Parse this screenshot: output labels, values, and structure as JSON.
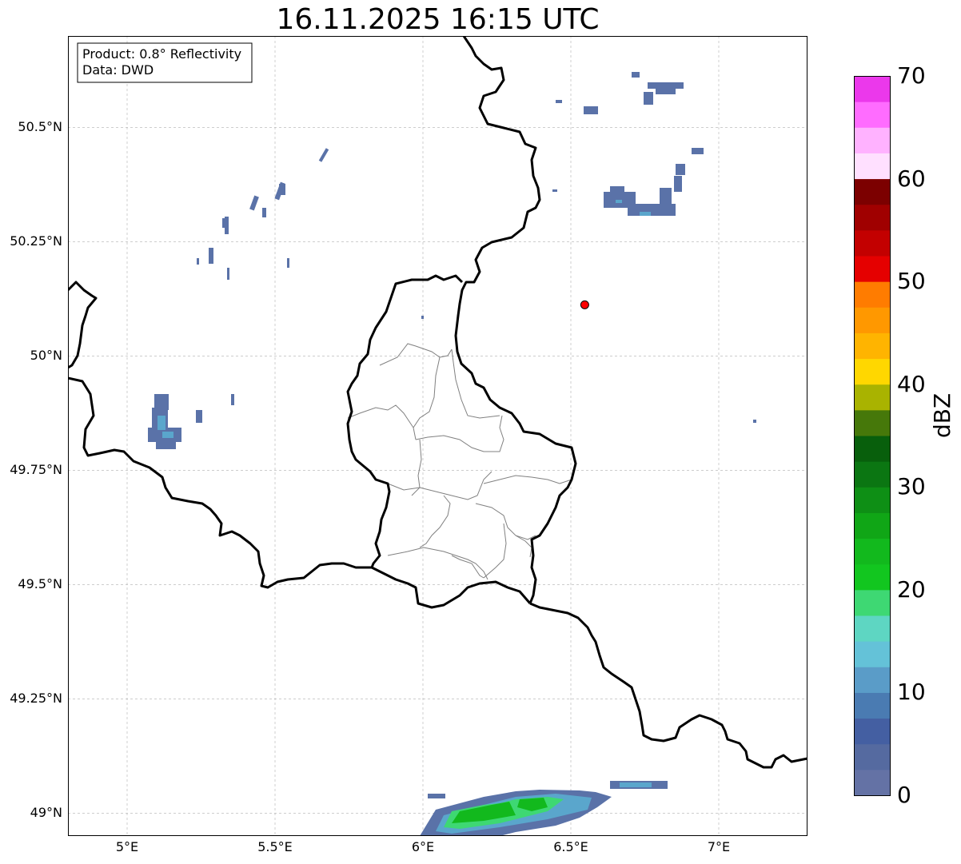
{
  "title": "16.11.2025 16:15 UTC",
  "info_box": {
    "line1": "Product: 0.8° Reflectivity",
    "line2": "Data: DWD"
  },
  "extent": {
    "lon_min": 4.8,
    "lon_max": 7.3,
    "lat_min": 48.95,
    "lat_max": 50.7
  },
  "axes": {
    "lon_ticks": [
      {
        "value": 5.0,
        "label": "5°E"
      },
      {
        "value": 5.5,
        "label": "5.5°E"
      },
      {
        "value": 6.0,
        "label": "6°E"
      },
      {
        "value": 6.5,
        "label": "6.5°E"
      },
      {
        "value": 7.0,
        "label": "7°E"
      }
    ],
    "lat_ticks": [
      {
        "value": 50.5,
        "label": "50.5°N"
      },
      {
        "value": 50.25,
        "label": "50.25°N"
      },
      {
        "value": 50.0,
        "label": "50°N"
      },
      {
        "value": 49.75,
        "label": "49.75°N"
      },
      {
        "value": 49.5,
        "label": "49.5°N"
      },
      {
        "value": 49.25,
        "label": "49.25°N"
      },
      {
        "value": 49.0,
        "label": "49°N"
      }
    ],
    "grid": true
  },
  "marker": {
    "lon": 6.547,
    "lat": 50.112,
    "color": "#ff0000",
    "icon": "radar-site-dot"
  },
  "colorbar": {
    "label": "dBZ",
    "min": 0,
    "max": 70,
    "ticks": [
      {
        "value": 0,
        "label": "0"
      },
      {
        "value": 10,
        "label": "10"
      },
      {
        "value": 20,
        "label": "20"
      },
      {
        "value": 30,
        "label": "30"
      },
      {
        "value": 40,
        "label": "40"
      },
      {
        "value": 50,
        "label": "50"
      },
      {
        "value": 60,
        "label": "60"
      },
      {
        "value": 70,
        "label": "70"
      }
    ],
    "colors": [
      "#6472a5",
      "#556aa0",
      "#445fa2",
      "#4a7bb2",
      "#5a9cc8",
      "#64c2d8",
      "#5ed6c2",
      "#3ed873",
      "#12c61f",
      "#12b91d",
      "#10a616",
      "#0e8f15",
      "#0b7612",
      "#085f0c",
      "#46780a",
      "#a9b300",
      "#ffd700",
      "#ffb400",
      "#ff9800",
      "#ff7c00",
      "#e50000",
      "#c30000",
      "#a00000",
      "#7c0000",
      "#ffe0ff",
      "#ffb2ff",
      "#ff6cff",
      "#eb38eb"
    ]
  },
  "echo_colors": {
    "weak": "#5a72a8",
    "light": "#5aa6cc",
    "moderate": "#3ed873",
    "strong": "#12b91d"
  }
}
